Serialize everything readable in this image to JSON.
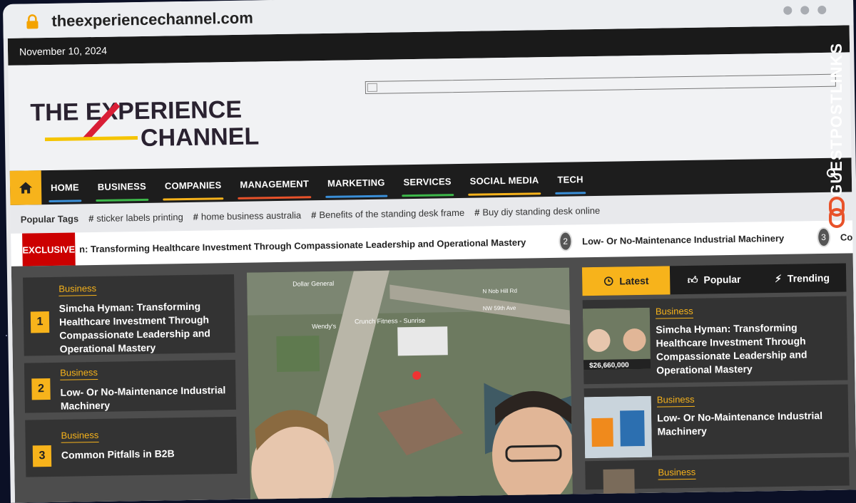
{
  "browser": {
    "url": "theexperiencechannel.com"
  },
  "topbar": {
    "date": "November 10, 2024"
  },
  "logo": {
    "line1": "THE EXPERIENCE",
    "line2": "CHANNEL"
  },
  "nav": {
    "items": [
      {
        "label": "HOME",
        "color": "#3a8fd8"
      },
      {
        "label": "BUSINESS",
        "color": "#3db84a"
      },
      {
        "label": "COMPANIES",
        "color": "#f7b31b"
      },
      {
        "label": "MANAGEMENT",
        "color": "#e8522a"
      },
      {
        "label": "MARKETING",
        "color": "#3a8fd8"
      },
      {
        "label": "SERVICES",
        "color": "#3db84a"
      },
      {
        "label": "SOCIAL MEDIA",
        "color": "#f7b31b"
      },
      {
        "label": "TECH",
        "color": "#3a8fd8"
      }
    ]
  },
  "tags": {
    "label": "Popular Tags",
    "items": [
      "sticker labels printing",
      "home business australia",
      "Benefits of the standing desk frame",
      "Buy diy standing desk online"
    ]
  },
  "ticker": {
    "badge": "EXCLUSIVE",
    "item1": "n: Transforming Healthcare Investment Through Compassionate Leadership and Operational Mastery",
    "num2": "2",
    "item2": "Low- Or No-Maintenance Industrial Machinery",
    "num3": "3",
    "item3": "Co"
  },
  "left_list": [
    {
      "num": "1",
      "category": "Business",
      "title": "Simcha Hyman: Transforming Healthcare Investment Through Compassionate Leadership and Operational Mastery"
    },
    {
      "num": "2",
      "category": "Business",
      "title": "Low- Or No-Maintenance Industrial Machinery"
    },
    {
      "num": "3",
      "category": "Business",
      "title": "Common Pitfalls in B2B"
    }
  ],
  "map_labels": {
    "a": "Dollar General",
    "b": "Wendy's",
    "c": "Crunch Fitness - Sunrise",
    "d": "N Nob Hill Rd",
    "e": "NW 59th Ave"
  },
  "tabs": {
    "latest": "Latest",
    "popular": "Popular",
    "trending": "Trending"
  },
  "right_list": [
    {
      "category": "Business",
      "title": "Simcha Hyman: Transforming Healthcare Investment Through Compassionate Leadership and Operational Mastery",
      "thumb_caption": "$26,660,000"
    },
    {
      "category": "Business",
      "title": "Low- Or No-Maintenance Industrial Machinery"
    },
    {
      "category": "Business"
    }
  ],
  "watermark": "GUESTPOSTLINKS",
  "colors": {
    "accent": "#f7b31b",
    "exclusive": "#cc0000",
    "dark": "#1d1d1d"
  }
}
